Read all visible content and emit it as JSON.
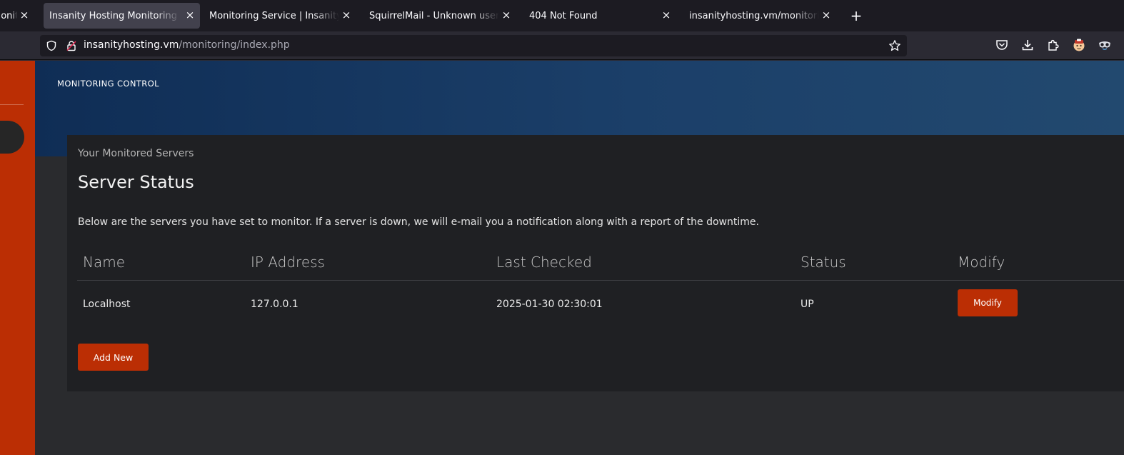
{
  "browser": {
    "tabs": [
      {
        "title": "Monitor",
        "active": false
      },
      {
        "title": "Insanity Hosting Monitoring S",
        "active": true
      },
      {
        "title": "Monitoring Service | Insanity H",
        "active": false
      },
      {
        "title": "SquirrelMail - Unknown user o",
        "active": false
      },
      {
        "title": "404 Not Found",
        "active": false
      },
      {
        "title": "insanityhosting.vm/monitoring",
        "active": false
      }
    ],
    "close_glyph": "×",
    "new_tab_glyph": "+",
    "url_host": "insanityhosting.vm",
    "url_path": "/monitoring/index.php",
    "toolbar_icons": [
      "pocket-icon",
      "download-icon",
      "extensions-icon",
      "profile-avatar-icon",
      "vpn-mask-icon"
    ]
  },
  "header": {
    "label": "MONITORING CONTROL"
  },
  "card": {
    "subtitle": "Your Monitored Servers",
    "title": "Server Status",
    "description": "Below are the servers you have set to monitor. If a server is down, we will e-mail you a notification along with a report of the downtime."
  },
  "table": {
    "headers": [
      "Name",
      "IP Address",
      "Last Checked",
      "Status",
      "Modify"
    ],
    "rows": [
      {
        "name": "Localhost",
        "ip": "127.0.0.1",
        "last_checked": "2025-01-30 02:30:01",
        "status": "UP",
        "action": "Modify"
      }
    ]
  },
  "add_button_label": "Add New",
  "colors": {
    "accent": "#bb2e04",
    "hero_start": "#0f2d55",
    "hero_end": "#22496f",
    "card": "#1f2023"
  }
}
